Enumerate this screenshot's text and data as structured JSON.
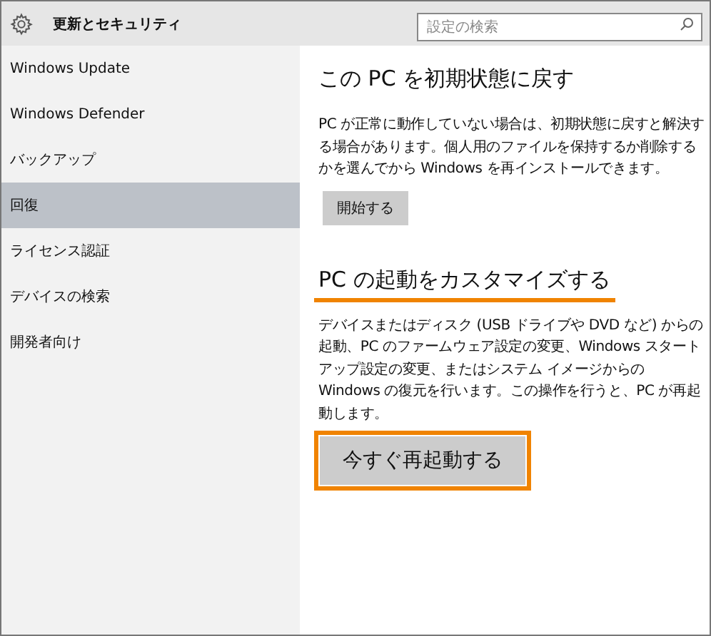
{
  "window": {
    "title": "更新とセキュリティ"
  },
  "search": {
    "placeholder": "設定の検索"
  },
  "sidebar": {
    "items": [
      {
        "label": "Windows Update",
        "selected": false
      },
      {
        "label": "Windows Defender",
        "selected": false
      },
      {
        "label": "バックアップ",
        "selected": false
      },
      {
        "label": "回復",
        "selected": true
      },
      {
        "label": "ライセンス認証",
        "selected": false
      },
      {
        "label": "デバイスの検索",
        "selected": false
      },
      {
        "label": "開発者向け",
        "selected": false
      }
    ]
  },
  "sections": [
    {
      "heading": "この PC を初期状態に戻す",
      "text": "PC が正常に動作していない場合は、初期状態に戻すと解決する場合があります。個人用のファイルを保持するか削除するかを選んでから Windows を再インストールできます。",
      "button": "開始する",
      "highlighted": false
    },
    {
      "heading": "PC の起動をカスタマイズする",
      "text": "デバイスまたはディスク (USB ドライブや DVD など) からの起動、PC のファームウェア設定の変更、Windows スタートアップ設定の変更、またはシステム イメージからの Windows の復元を行います。この操作を行うと、PC が再起動します。",
      "button": "今すぐ再起動する",
      "highlighted": true
    }
  ]
}
